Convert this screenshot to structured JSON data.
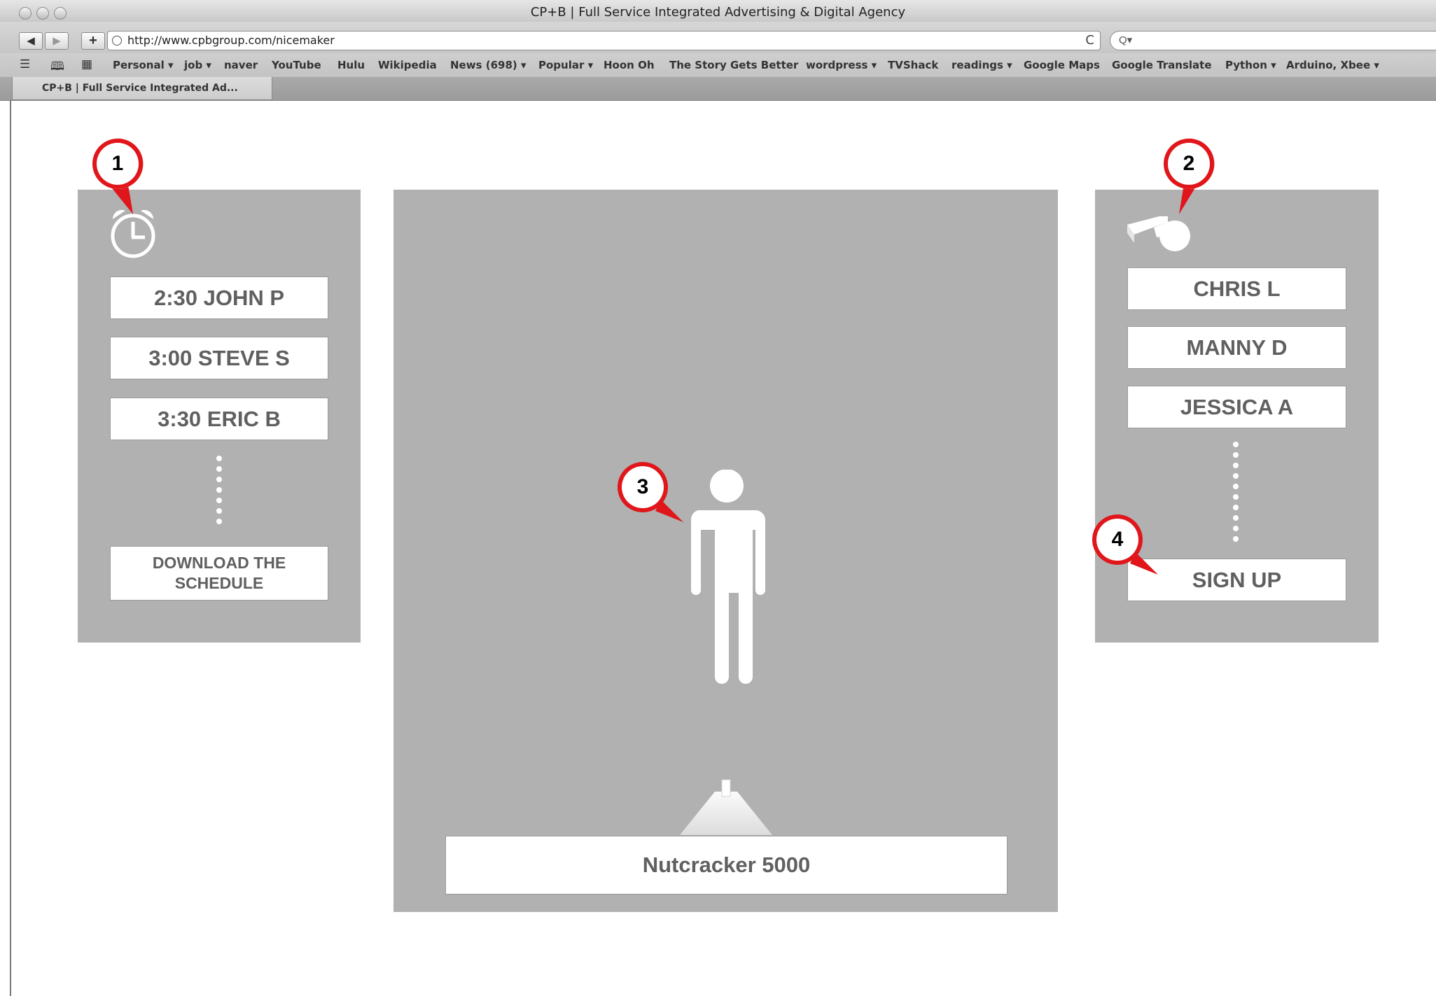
{
  "window": {
    "title": "CP+B | Full Service Integrated Advertising & Digital Agency"
  },
  "toolbar": {
    "back": "◀",
    "forward": "▶",
    "add": "+",
    "url": "http://www.cpbgroup.com/nicemaker",
    "reload": "C",
    "search_placeholder": "Q▾"
  },
  "bookmarks": [
    "Personal ▾",
    "job ▾",
    "naver",
    "YouTube",
    "Hulu",
    "Wikipedia",
    "News (698) ▾",
    "Popular ▾",
    "Hoon Oh",
    "The Story Gets Better",
    "wordpress ▾",
    "TVShack",
    "readings ▾",
    "Google Maps",
    "Google Translate",
    "Python ▾",
    "Arduino, Xbee ▾"
  ],
  "tab": {
    "title": "CP+B | Full Service Integrated Ad..."
  },
  "schedule": {
    "icon": "alarm-clock-icon",
    "items": [
      "2:30 JOHN P",
      "3:00 STEVE S",
      "3:30 ERIC B"
    ],
    "download_label": "DOWNLOAD THE SCHEDULE"
  },
  "coaches": {
    "icon": "whistle-icon",
    "items": [
      "CHRIS L",
      "MANNY D",
      "JESSICA A"
    ],
    "signup_label": "SIGN UP"
  },
  "stage": {
    "figure_icon": "person-icon",
    "light_icon": "spotlight-icon",
    "name": "Nutcracker 5000"
  },
  "markers": [
    "1",
    "2",
    "3",
    "4"
  ],
  "colors": {
    "panel": "#b1b1b1",
    "marker_red": "#e0161b",
    "slot_text": "#606060"
  }
}
